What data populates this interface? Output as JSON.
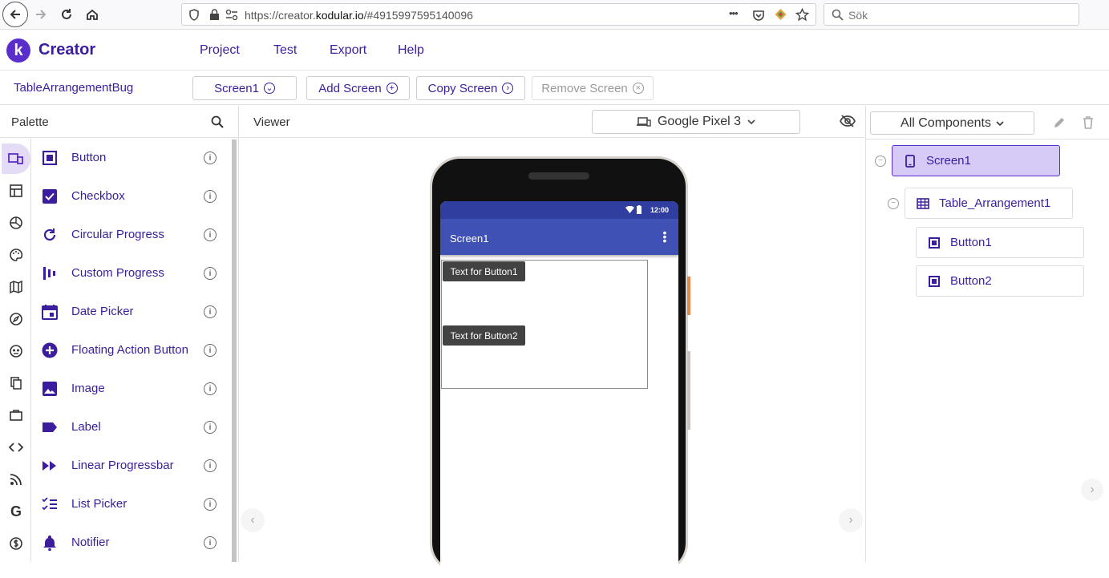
{
  "browser": {
    "url_prefix": "https://creator.",
    "url_domain": "kodular.io",
    "url_suffix": "/#4915997595140096",
    "search_placeholder": "Sök",
    "more_glyph": "•••"
  },
  "app": {
    "logo_letter": "k",
    "brand": "Creator",
    "menu": [
      "Project",
      "Test",
      "Export",
      "Help"
    ]
  },
  "toolbar": {
    "project_name": "TableArrangementBug",
    "screen_select": "Screen1",
    "add_screen": "Add Screen",
    "copy_screen": "Copy Screen",
    "remove_screen": "Remove Screen"
  },
  "palette": {
    "title": "Palette",
    "items": [
      {
        "label": "Button",
        "icon": "button-icon"
      },
      {
        "label": "Checkbox",
        "icon": "checkbox-icon"
      },
      {
        "label": "Circular Progress",
        "icon": "circular-progress-icon"
      },
      {
        "label": "Custom Progress",
        "icon": "custom-progress-icon"
      },
      {
        "label": "Date Picker",
        "icon": "calendar-icon"
      },
      {
        "label": "Floating Action Button",
        "icon": "plus-circle-icon"
      },
      {
        "label": "Image",
        "icon": "image-icon"
      },
      {
        "label": "Label",
        "icon": "label-icon"
      },
      {
        "label": "Linear Progressbar",
        "icon": "fast-forward-icon"
      },
      {
        "label": "List Picker",
        "icon": "list-check-icon"
      },
      {
        "label": "Notifier",
        "icon": "bell-icon"
      }
    ],
    "categories": [
      "user-interface-icon",
      "layout-icon",
      "media-icon",
      "drawing-icon",
      "maps-icon",
      "sensors-icon",
      "social-icon",
      "storage-icon",
      "utilities-icon",
      "connectivity-icon",
      "feed-icon",
      "google-icon",
      "monetization-icon"
    ]
  },
  "viewer": {
    "title": "Viewer",
    "device": "Google Pixel 3",
    "phone": {
      "time": "12:00",
      "screen_title": "Screen1",
      "button1": "Text for Button1",
      "button2": "Text for Button2"
    }
  },
  "components": {
    "filter": "All Components",
    "tree": {
      "screen": "Screen1",
      "table": "Table_Arrangement1",
      "buttons": [
        "Button1",
        "Button2"
      ]
    }
  }
}
